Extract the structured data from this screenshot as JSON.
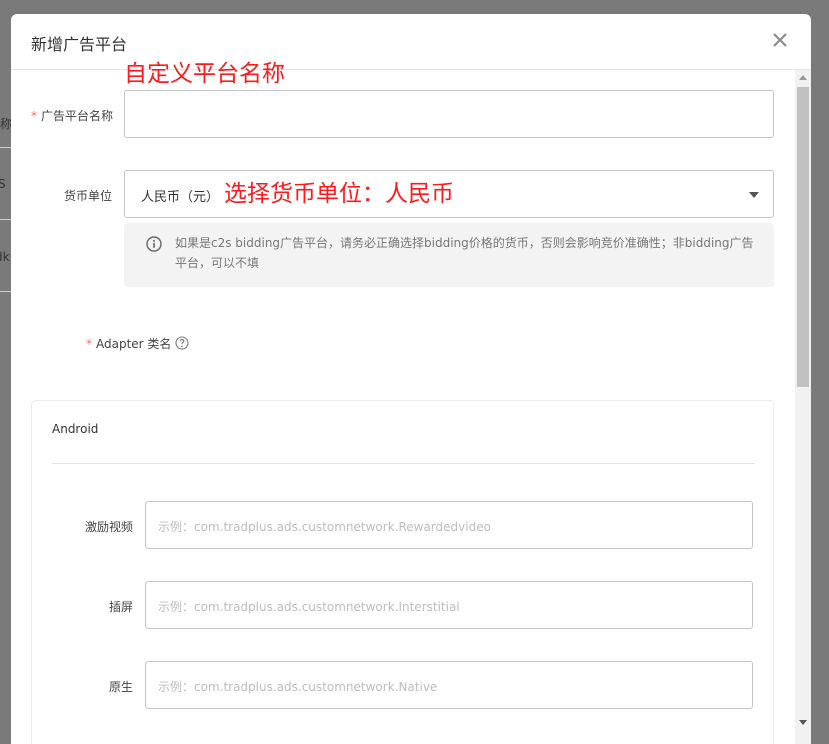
{
  "background": {
    "fragments": [
      "名称",
      "S",
      "dk"
    ]
  },
  "modal": {
    "title": "新增广告平台"
  },
  "annotations": {
    "name_note": "自定义平台名称",
    "currency_note": "选择货币单位：人民币"
  },
  "form": {
    "platform_name": {
      "required_mark": "*",
      "label": "广告平台名称",
      "value": ""
    },
    "currency": {
      "label": "货币单位",
      "selected": "人民币（元）"
    },
    "hint": "如果是c2s bidding广告平台，请务必正确选择bidding价格的货币，否则会影响竞价准确性；非bidding广告平台，可以不填",
    "adapter": {
      "required_mark": "*",
      "label": "Adapter 类名",
      "help_icon": "question-circle-icon"
    },
    "android": {
      "title": "Android",
      "fields": [
        {
          "label": "激励视频",
          "placeholder": "示例：com.tradplus.ads.customnetwork.Rewardedvideo"
        },
        {
          "label": "插屏",
          "placeholder": "示例：com.tradplus.ads.customnetwork.Interstitial"
        },
        {
          "label": "原生",
          "placeholder": "示例：com.tradplus.ads.customnetwork.Native"
        }
      ]
    }
  },
  "colors": {
    "overlay": "#7a7a7a",
    "annotation": "#ff1a1a",
    "required": "#f56c6c",
    "hint_bg": "#f3f3f3"
  }
}
